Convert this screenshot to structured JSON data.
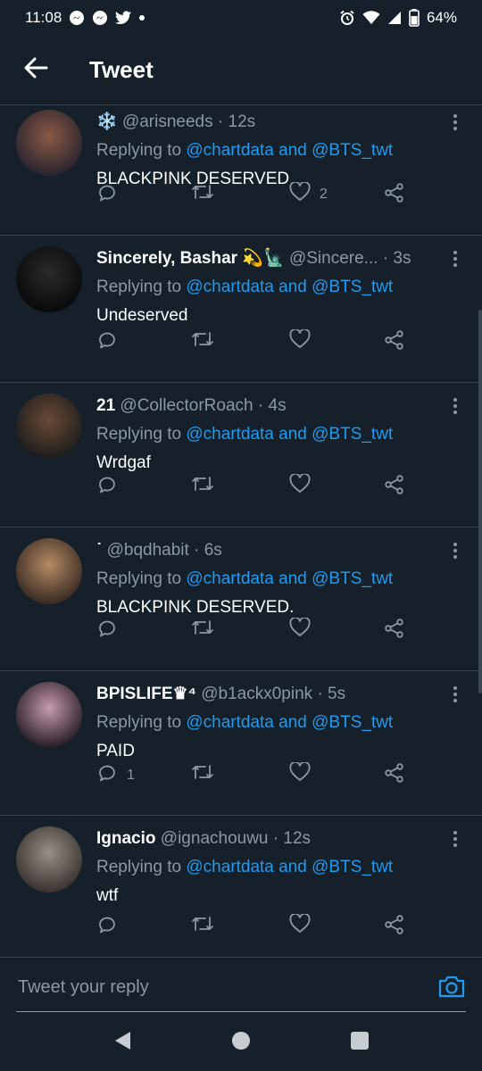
{
  "status_bar": {
    "time": "11:08",
    "battery": "64%",
    "left_icons": [
      "messenger-icon",
      "messenger-icon",
      "twitter-icon",
      "dot-icon"
    ],
    "right_icons": [
      "alarm-icon",
      "wifi-icon",
      "signal-icon",
      "battery-icon"
    ]
  },
  "header": {
    "title": "Tweet"
  },
  "tweets": [
    {
      "name": "",
      "name_emoji": "❄️",
      "handle": "@arisneeds",
      "time": "· 12s",
      "replying_label": "Replying to",
      "mention1": "@chartdata",
      "and_label": "and",
      "mention2": "@BTS_twt",
      "text": "BLACKPINK DESERVED",
      "reply_count": "",
      "like_count": "2",
      "avatar_colors": [
        "#8a5a44",
        "#2c2430"
      ]
    },
    {
      "name": "Sincerely, Bashar",
      "name_emoji": "💫🗽",
      "handle": "@Sincere...",
      "time": "· 3s",
      "replying_label": "Replying to",
      "mention1": "@chartdata",
      "and_label": "and",
      "mention2": "@BTS_twt",
      "text": "Undeserved",
      "reply_count": "",
      "like_count": "",
      "avatar_colors": [
        "#2a2a2a",
        "#0a0a0a"
      ]
    },
    {
      "name": "21",
      "name_emoji": "",
      "handle": "@CollectorRoach",
      "time": "· 4s",
      "replying_label": "Replying to",
      "mention1": "@chartdata",
      "and_label": "and",
      "mention2": "@BTS_twt",
      "text": "Wrdgaf",
      "reply_count": "",
      "like_count": "",
      "avatar_colors": [
        "#6b4a35",
        "#1d1d1d"
      ]
    },
    {
      "name": "˙",
      "name_emoji": "",
      "handle": "@bqdhabit",
      "time": "· 6s",
      "replying_label": "Replying to",
      "mention1": "@chartdata",
      "and_label": "and",
      "mention2": "@BTS_twt",
      "text": "BLACKPINK DESERVED.",
      "reply_count": "",
      "like_count": "",
      "avatar_colors": [
        "#b68b63",
        "#3b2c24"
      ]
    },
    {
      "name": "BPISLIFE♛⁴",
      "name_emoji": "",
      "handle": "@b1ackx0pink",
      "time": "· 5s",
      "replying_label": "Replying to",
      "mention1": "@chartdata",
      "and_label": "and",
      "mention2": "@BTS_twt",
      "text": "PAID",
      "reply_count": "1",
      "like_count": "",
      "avatar_colors": [
        "#c79bb0",
        "#2a1f28"
      ]
    },
    {
      "name": "Ignacio",
      "name_emoji": "",
      "handle": "@ignachouwu",
      "time": "· 12s",
      "replying_label": "Replying to",
      "mention1": "@chartdata",
      "and_label": "and",
      "mention2": "@BTS_twt",
      "text": "wtf",
      "reply_count": "",
      "like_count": "",
      "avatar_colors": [
        "#9a8f86",
        "#3a3431"
      ]
    }
  ],
  "reply_bar": {
    "placeholder": "Tweet your reply"
  },
  "colors": {
    "background": "#15202b",
    "accent": "#1d9bf0",
    "muted": "#8b98a5",
    "divider": "#38444d"
  }
}
